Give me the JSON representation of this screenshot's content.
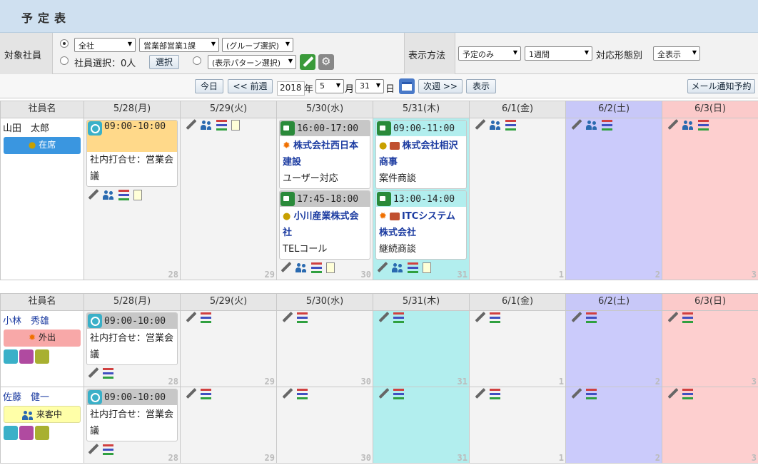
{
  "header": {
    "title": "予定表"
  },
  "filter": {
    "target_label": "対象社員",
    "scope_value": "全社",
    "dept_value": "営業部営業1課",
    "group_value": "(グループ選択)",
    "emp_select_label": "社員選択：0人",
    "select_button": "選択",
    "pattern_value": "(表示パターン選択)",
    "display_label": "表示方法",
    "display_value": "予定のみ",
    "period_value": "1週間",
    "type_label": "対応形態別",
    "type_value": "全表示"
  },
  "nav": {
    "today": "今日",
    "prev": "<< 前週",
    "year": "2018",
    "year_unit": "年",
    "month": "5",
    "month_unit": "月",
    "day": "31",
    "day_unit": "日",
    "next": "次週 >>",
    "show": "表示",
    "mail": "メール通知予約"
  },
  "table1": {
    "name_header": "社員名",
    "days": [
      "5/28(月)",
      "5/29(火)",
      "5/30(水)",
      "5/31(木)",
      "6/1(金)",
      "6/2(土)",
      "6/3(日)"
    ],
    "daynums": [
      "28",
      "29",
      "30",
      "31",
      "1",
      "2",
      "3"
    ],
    "employee": "山田　太郎",
    "status": "在席",
    "ev_mon": {
      "time": "09:00-10:00",
      "text": "社内打合せ：営業会議"
    },
    "ev_wed1": {
      "time": "16:00-17:00",
      "title": "株式会社西日本建設",
      "note": "ユーザー対応"
    },
    "ev_wed2": {
      "time": "17:45-18:00",
      "title": "小川産業株式会社",
      "note": "TELコール"
    },
    "ev_thu1": {
      "time": "09:00-11:00",
      "title": "株式会社相沢商事",
      "note": "案件商談"
    },
    "ev_thu2": {
      "time": "13:00-14:00",
      "title": "ITCシステム株式会社",
      "note": "継続商談"
    }
  },
  "table2": {
    "name_header": "社員名",
    "days": [
      "5/28(月)",
      "5/29(火)",
      "5/30(水)",
      "5/31(木)",
      "6/1(金)",
      "6/2(土)",
      "6/3(日)"
    ],
    "daynums": [
      "28",
      "29",
      "30",
      "31",
      "1",
      "2",
      "3"
    ],
    "emp1": "小林　秀雄",
    "emp1_status": "外出",
    "emp2": "佐藤　健一",
    "emp2_status": "来客中",
    "ev_text": "社内打合せ：営業会議",
    "ev_time": "09:00-10:00"
  }
}
